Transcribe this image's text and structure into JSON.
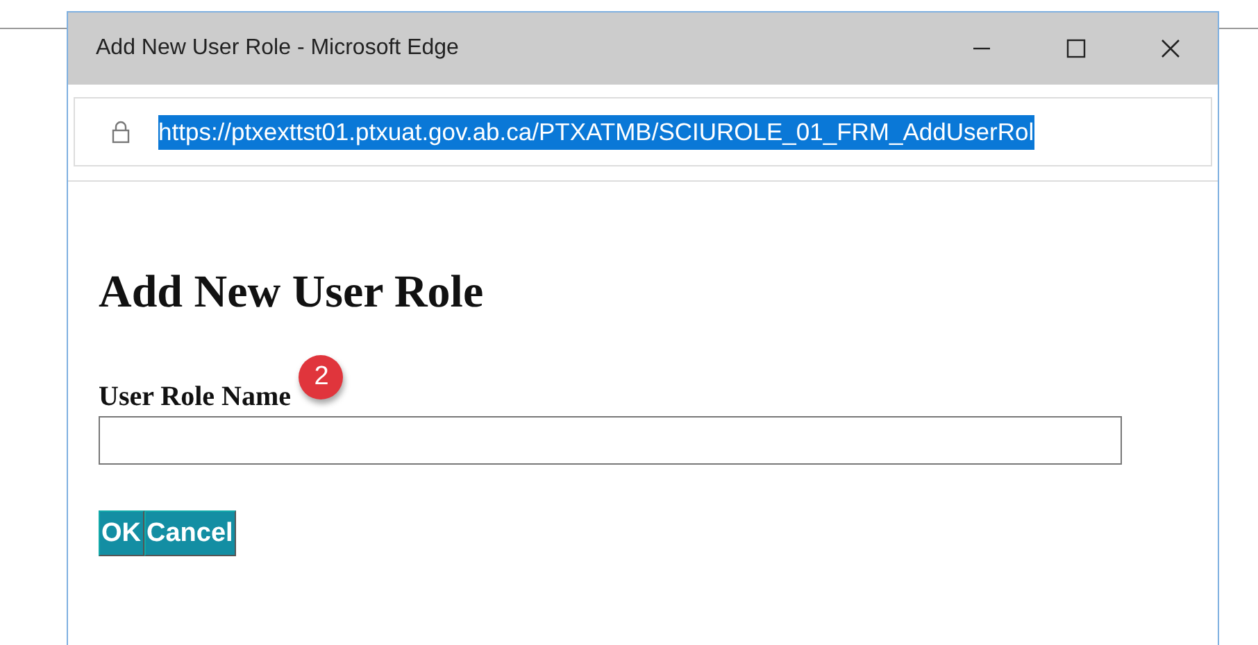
{
  "window": {
    "title": "Add New User Role - Microsoft Edge"
  },
  "address_bar": {
    "url": "https://ptxexttst01.ptxuat.gov.ab.ca/PTXATMB/SCIUROLE_01_FRM_AddUserRol",
    "selected": true
  },
  "page": {
    "heading": "Add New User Role",
    "field_label": "User Role Name",
    "badge": "2",
    "buttons": [
      "OK",
      "Cancel"
    ]
  }
}
